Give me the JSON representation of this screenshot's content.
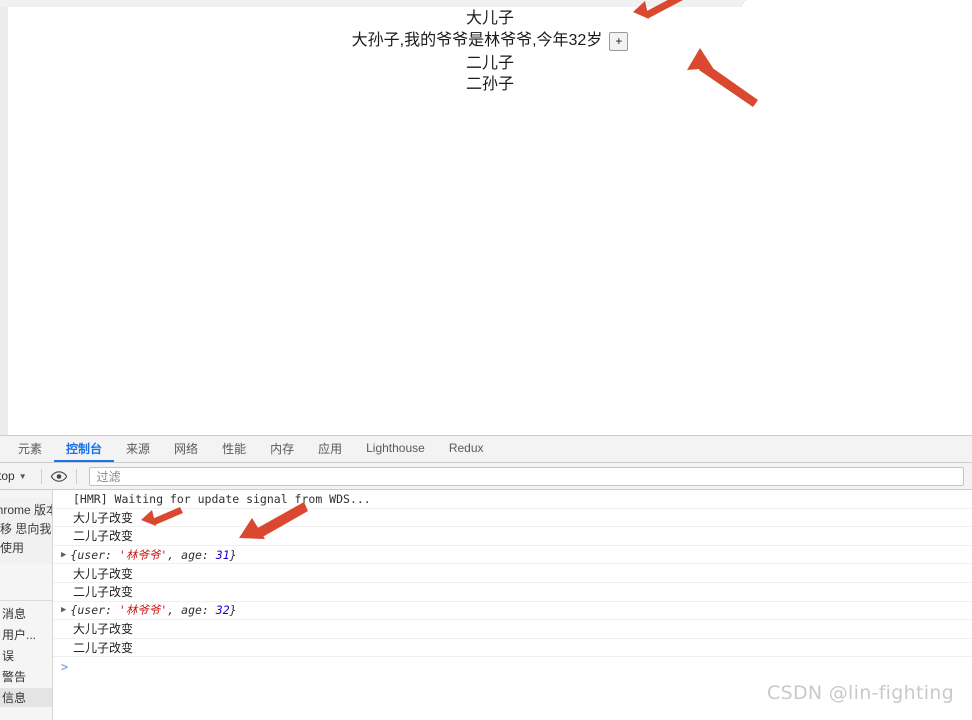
{
  "page": {
    "lines": [
      {
        "text": "大儿子"
      },
      {
        "text": "大孙子,我的爷爷是林爷爷,今年32岁",
        "button": "+"
      },
      {
        "text": "二儿子"
      },
      {
        "text": "二孙子"
      }
    ],
    "add_button_label": "+"
  },
  "devtools": {
    "tabs": [
      {
        "label": "元素",
        "active": false
      },
      {
        "label": "控制台",
        "active": true
      },
      {
        "label": "来源",
        "active": false
      },
      {
        "label": "网络",
        "active": false
      },
      {
        "label": "性能",
        "active": false
      },
      {
        "label": "内存",
        "active": false
      },
      {
        "label": "应用",
        "active": false
      },
      {
        "label": "Lighthouse",
        "active": false
      },
      {
        "label": "Redux",
        "active": false
      }
    ],
    "toolbar": {
      "context_value": "top",
      "context_caret": "▼",
      "eye_icon": "eye-icon",
      "filter_placeholder": "过滤"
    },
    "sidebar": {
      "notice": "Chrome 版本中移 思向我们 制使用",
      "filters": [
        {
          "label": "消息",
          "selected": false
        },
        {
          "label": "用户...",
          "selected": false
        },
        {
          "label": "误",
          "selected": false
        },
        {
          "label": "警告",
          "selected": false
        },
        {
          "label": "信息",
          "selected": true
        }
      ]
    },
    "console": {
      "messages": [
        {
          "type": "mono",
          "text": "[HMR] Waiting for update signal from WDS..."
        },
        {
          "type": "text",
          "text": "大儿子改变"
        },
        {
          "type": "text",
          "text": "二儿子改变"
        },
        {
          "type": "object",
          "user_key": "user:",
          "user_value": "'林爷爷'",
          "age_key": "age:",
          "age_value": "31"
        },
        {
          "type": "text",
          "text": "大儿子改变"
        },
        {
          "type": "text",
          "text": "二儿子改变"
        },
        {
          "type": "object",
          "user_key": "user:",
          "user_value": "'林爷爷'",
          "age_key": "age:",
          "age_value": "32"
        },
        {
          "type": "text",
          "text": "大儿子改变"
        },
        {
          "type": "text",
          "text": "二儿子改变"
        }
      ],
      "prompt_symbol": ">"
    }
  },
  "annotations": {
    "arrow_color": "#d9482f",
    "count": 4
  },
  "watermark": {
    "text": "CSDN @lin-fighting"
  }
}
